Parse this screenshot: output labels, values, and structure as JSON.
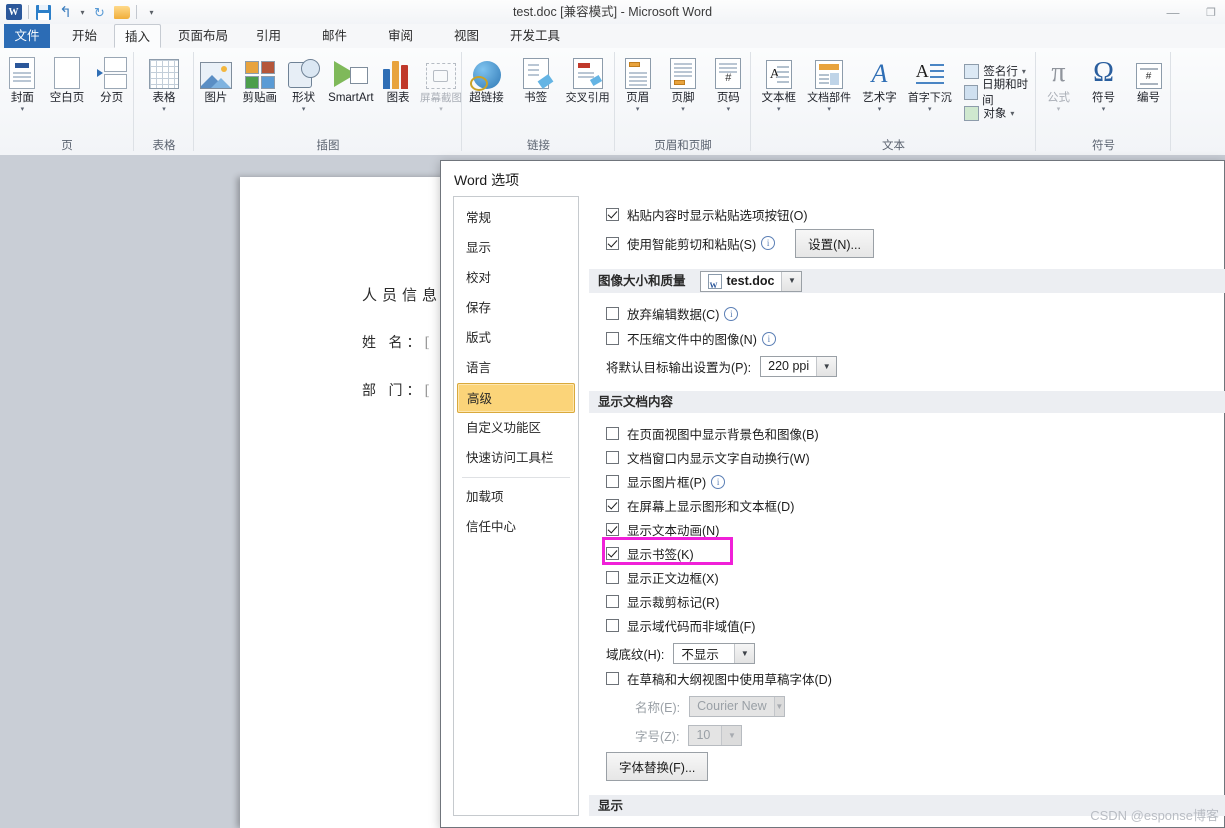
{
  "window": {
    "title": "test.doc [兼容模式]  -  Microsoft Word",
    "minimize": "—",
    "maximize": "❐",
    "wordmark": "W"
  },
  "qat": {
    "save": "save-icon",
    "undo": "↺",
    "redo": "↻",
    "open": "open-icon",
    "more": "▾"
  },
  "tabs": [
    {
      "label": "文件"
    },
    {
      "label": "开始"
    },
    {
      "label": "插入"
    },
    {
      "label": "页面布局"
    },
    {
      "label": "引用"
    },
    {
      "label": "邮件"
    },
    {
      "label": "审阅"
    },
    {
      "label": "视图"
    },
    {
      "label": "开发工具"
    }
  ],
  "ribbon": {
    "groups": [
      {
        "name": "页",
        "buttons": [
          {
            "label": "封面",
            "dropdown": "▾"
          },
          {
            "label": "空白页",
            "dropdown": ""
          },
          {
            "label": "分页",
            "dropdown": ""
          }
        ]
      },
      {
        "name": "表格",
        "buttons": [
          {
            "label": "表格",
            "dropdown": "▾"
          }
        ]
      },
      {
        "name": "插图",
        "buttons": [
          {
            "label": "图片",
            "dropdown": ""
          },
          {
            "label": "剪贴画",
            "dropdown": ""
          },
          {
            "label": "形状",
            "dropdown": "▾"
          },
          {
            "label": "SmartArt",
            "dropdown": ""
          },
          {
            "label": "图表",
            "dropdown": ""
          },
          {
            "label": "屏幕截图",
            "dropdown": "▾"
          }
        ]
      },
      {
        "name": "链接",
        "buttons": [
          {
            "label": "超链接",
            "dropdown": ""
          },
          {
            "label": "书签",
            "dropdown": ""
          },
          {
            "label": "交叉引用",
            "dropdown": ""
          }
        ]
      },
      {
        "name": "页眉和页脚",
        "buttons": [
          {
            "label": "页眉",
            "dropdown": "▾"
          },
          {
            "label": "页脚",
            "dropdown": "▾"
          },
          {
            "label": "页码",
            "dropdown": "▾"
          }
        ]
      },
      {
        "name": "文本",
        "buttons": [
          {
            "label": "文本框",
            "dropdown": "▾"
          },
          {
            "label": "文档部件",
            "dropdown": "▾"
          },
          {
            "label": "艺术字",
            "dropdown": "▾"
          },
          {
            "label": "首字下沉",
            "dropdown": "▾"
          }
        ],
        "small_buttons": [
          {
            "label": "签名行",
            "dropdown": "▾"
          },
          {
            "label": "日期和时间",
            "dropdown": ""
          },
          {
            "label": "对象",
            "dropdown": "▾"
          }
        ]
      },
      {
        "name": "符号",
        "buttons": [
          {
            "label": "公式",
            "dropdown": "▾"
          },
          {
            "label": "符号",
            "dropdown": "▾"
          },
          {
            "label": "编号",
            "dropdown": ""
          }
        ]
      }
    ]
  },
  "document": {
    "title": "人员信息",
    "lines": [
      {
        "label": "姓 名：",
        "bracket": "["
      },
      {
        "label": "部 门：",
        "bracket": "["
      }
    ]
  },
  "dialog": {
    "title": "Word 选项",
    "nav": [
      {
        "label": "常规",
        "selected": false
      },
      {
        "label": "显示",
        "selected": false
      },
      {
        "label": "校对",
        "selected": false
      },
      {
        "label": "保存",
        "selected": false
      },
      {
        "label": "版式",
        "selected": false
      },
      {
        "label": "语言",
        "selected": false
      },
      {
        "label": "高级",
        "selected": true
      },
      {
        "label": "自定义功能区",
        "selected": false
      },
      {
        "label": "快速访问工具栏",
        "selected": false
      },
      {
        "label": "加载项",
        "selected": false
      },
      {
        "label": "信任中心",
        "selected": false
      }
    ],
    "cut_paste": {
      "items": [
        {
          "label": "粘贴内容时显示粘贴选项按钮(O)",
          "checked": true,
          "info": false
        },
        {
          "label": "使用智能剪切和粘贴(S)",
          "checked": true,
          "info": true
        }
      ],
      "settings_button": "设置(N)..."
    },
    "image_section": {
      "heading": "图像大小和质量",
      "file_combo": "test.doc",
      "items": [
        {
          "label": "放弃编辑数据(C)",
          "checked": false,
          "info": true
        },
        {
          "label": "不压缩文件中的图像(N)",
          "checked": false,
          "info": true
        }
      ],
      "output_label": "将默认目标输出设置为(P):",
      "output_value": "220 ppi"
    },
    "show_content": {
      "heading": "显示文档内容",
      "items": [
        {
          "label": "在页面视图中显示背景色和图像(B)",
          "checked": false,
          "info": false
        },
        {
          "label": "文档窗口内显示文字自动换行(W)",
          "checked": false,
          "info": false
        },
        {
          "label": "显示图片框(P)",
          "checked": false,
          "info": true
        },
        {
          "label": "在屏幕上显示图形和文本框(D)",
          "checked": true,
          "info": false
        },
        {
          "label": "显示文本动画(N)",
          "checked": true,
          "info": false
        },
        {
          "label": "显示书签(K)",
          "checked": true,
          "info": false,
          "highlighted": true
        },
        {
          "label": "显示正文边框(X)",
          "checked": false,
          "info": false
        },
        {
          "label": "显示裁剪标记(R)",
          "checked": false,
          "info": false
        },
        {
          "label": "显示域代码而非域值(F)",
          "checked": false,
          "info": false
        }
      ],
      "field_shading_label": "域底纹(H):",
      "field_shading_value": "不显示",
      "draft_font": {
        "label": "在草稿和大纲视图中使用草稿字体(D)",
        "checked": false
      },
      "name_label": "名称(E):",
      "name_value": "Courier New",
      "size_label": "字号(Z):",
      "size_value": "10",
      "substitute_button": "字体替换(F)..."
    },
    "display_section": {
      "heading": "显示"
    },
    "highlight_color": "#f020d8"
  },
  "watermark": "CSDN @esponse博客"
}
